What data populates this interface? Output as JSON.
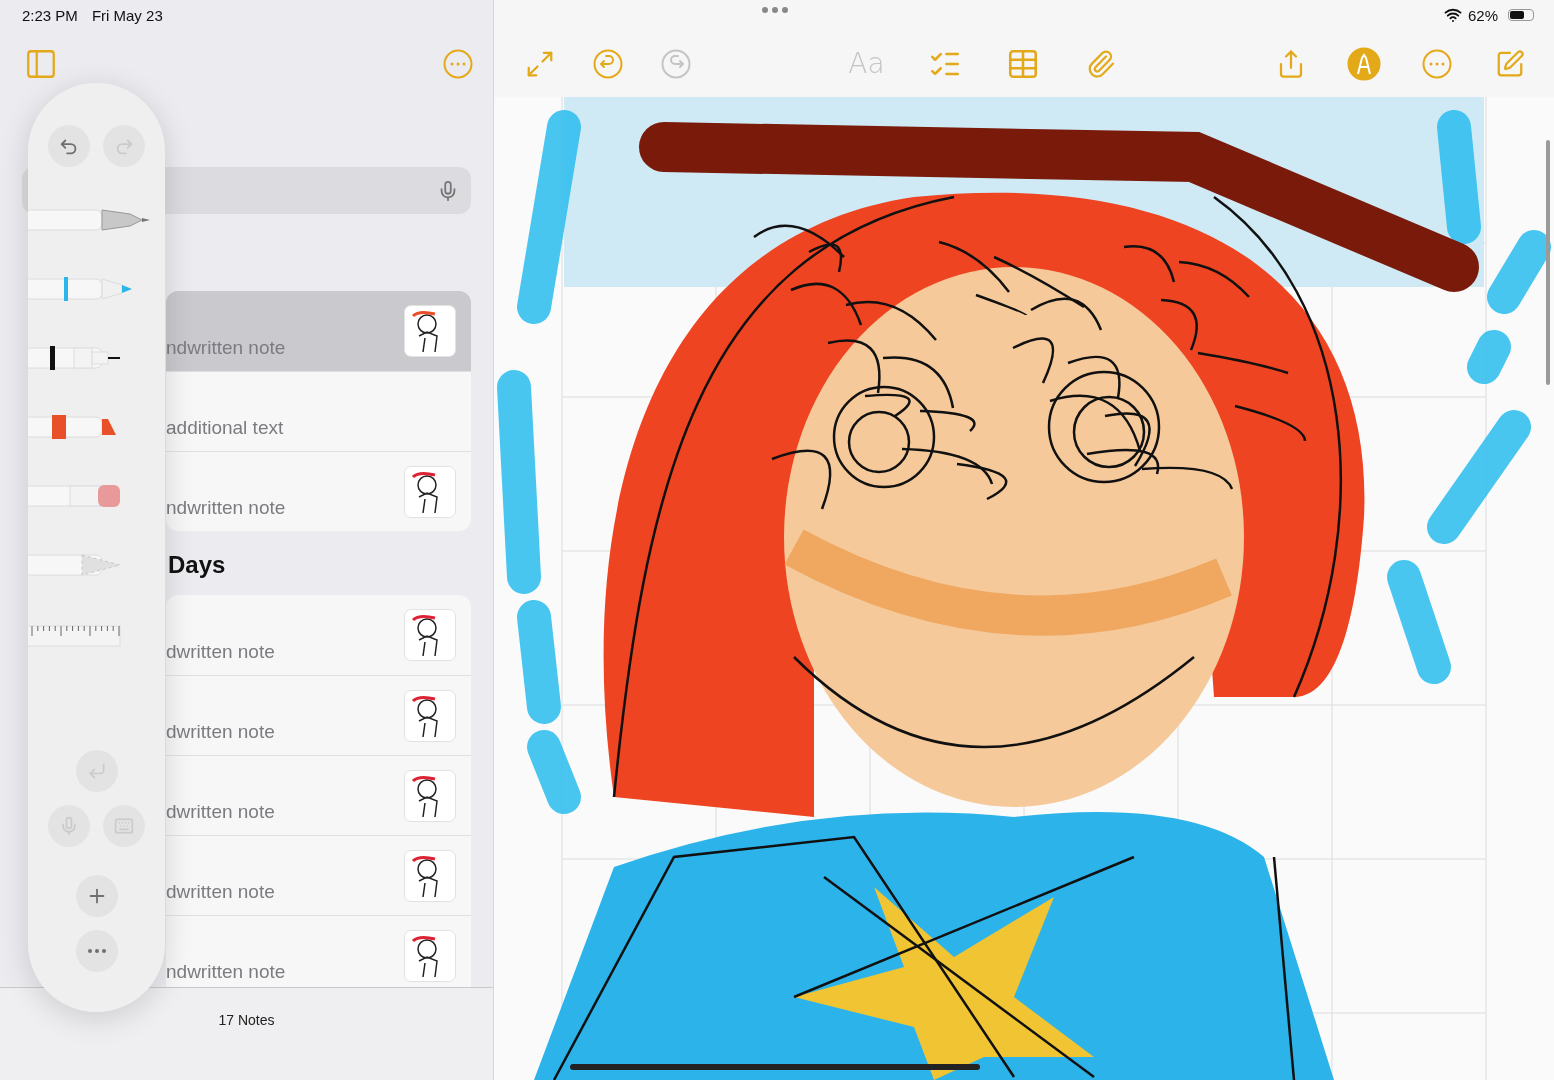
{
  "status_bar": {
    "time": "2:23 PM",
    "date": "Fri May 23",
    "battery": "62%"
  },
  "sidebar": {
    "groups": [
      {
        "notes": [
          {
            "snippet": "ndwritten note",
            "kind": "drawing",
            "selected": true
          },
          {
            "snippet": "additional text",
            "kind": "text",
            "selected": false
          },
          {
            "snippet": "ndwritten note",
            "kind": "drawing",
            "selected": false
          }
        ]
      },
      {
        "heading": "Days",
        "notes": [
          {
            "snippet": "dwritten note",
            "kind": "drawing",
            "selected": false
          },
          {
            "snippet": "dwritten note",
            "kind": "drawing",
            "selected": false
          },
          {
            "snippet": "dwritten note",
            "kind": "drawing",
            "selected": false
          },
          {
            "snippet": "dwritten note",
            "kind": "drawing",
            "selected": false
          },
          {
            "snippet": "ndwritten note",
            "kind": "drawing",
            "selected": false
          }
        ]
      }
    ],
    "footer": "17 Notes"
  },
  "palette": {
    "redo_disabled": true,
    "tools": [
      {
        "kind": "monoline"
      },
      {
        "kind": "pen",
        "color": "#2cb5e8"
      },
      {
        "kind": "fineliner",
        "color": "#111111"
      },
      {
        "kind": "marker",
        "color": "#e8502a"
      },
      {
        "kind": "eraser"
      },
      {
        "kind": "lasso"
      },
      {
        "kind": "ruler"
      }
    ]
  },
  "toolbar": [
    {
      "kind": "expand",
      "disabled": false
    },
    {
      "kind": "undo",
      "disabled": false
    },
    {
      "kind": "redo",
      "disabled": true
    },
    {
      "kind": "format",
      "label": "Aa",
      "disabled": true
    },
    {
      "kind": "checklist",
      "disabled": false
    },
    {
      "kind": "table",
      "disabled": false
    },
    {
      "kind": "attach",
      "disabled": false
    },
    {
      "kind": "share",
      "disabled": false
    },
    {
      "kind": "markup",
      "disabled": false
    },
    {
      "kind": "more",
      "disabled": false
    },
    {
      "kind": "compose",
      "disabled": false
    }
  ]
}
